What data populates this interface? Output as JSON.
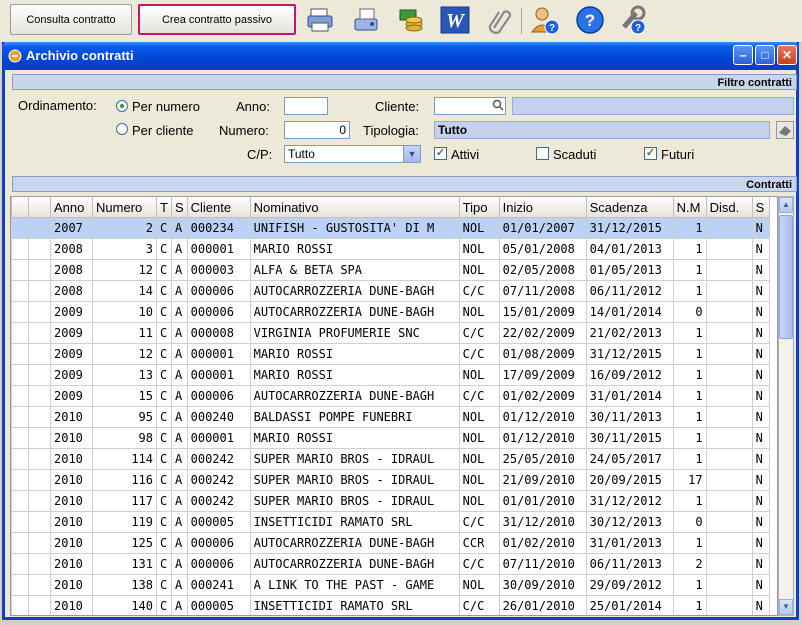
{
  "toolbar": {
    "btn_consulta": "Consulta contratto",
    "btn_crea": "Crea contratto passivo",
    "icons": [
      "printer-icon",
      "fax-icon",
      "money-icon",
      "word-icon",
      "paperclip-icon",
      "user-help-icon",
      "help-icon",
      "settings-help-icon"
    ]
  },
  "window": {
    "title": "Archivio contratti"
  },
  "filter": {
    "header": "Filtro contratti",
    "ordinamento_label": "Ordinamento:",
    "per_numero": "Per numero",
    "per_cliente": "Per cliente",
    "anno_label": "Anno:",
    "anno_value": "",
    "numero_label": "Numero:",
    "numero_value": "0",
    "cliente_label": "Cliente:",
    "cliente_value": "",
    "cliente_desc": "",
    "tipologia_label": "Tipologia:",
    "tipologia_value": "Tutto",
    "cp_label": "C/P:",
    "cp_value": "Tutto",
    "attivi": "Attivi",
    "scaduti": "Scaduti",
    "futuri": "Futuri",
    "attivi_checked": true,
    "scaduti_checked": false,
    "futuri_checked": true
  },
  "contracts": {
    "header": "Contratti",
    "columns": [
      "Anno",
      "Numero",
      "T",
      "S",
      "Cliente",
      "Nominativo",
      "Tipo",
      "Inizio",
      "Scadenza",
      "N.M",
      "Disd.",
      "S"
    ],
    "rows": [
      [
        "2007",
        "2",
        "C",
        "A",
        "000234",
        "UNIFISH - GUSTOSITA' DI M",
        "NOL",
        "01/01/2007",
        "31/12/2015",
        "1",
        "",
        "N"
      ],
      [
        "2008",
        "3",
        "C",
        "A",
        "000001",
        "MARIO ROSSI",
        "NOL",
        "05/01/2008",
        "04/01/2013",
        "1",
        "",
        "N"
      ],
      [
        "2008",
        "12",
        "C",
        "A",
        "000003",
        "ALFA & BETA SPA",
        "NOL",
        "02/05/2008",
        "01/05/2013",
        "1",
        "",
        "N"
      ],
      [
        "2008",
        "14",
        "C",
        "A",
        "000006",
        "AUTOCARROZZERIA DUNE-BAGH",
        "C/C",
        "07/11/2008",
        "06/11/2012",
        "1",
        "",
        "N"
      ],
      [
        "2009",
        "10",
        "C",
        "A",
        "000006",
        "AUTOCARROZZERIA DUNE-BAGH",
        "NOL",
        "15/01/2009",
        "14/01/2014",
        "0",
        "",
        "N"
      ],
      [
        "2009",
        "11",
        "C",
        "A",
        "000008",
        "VIRGINIA PROFUMERIE SNC",
        "C/C",
        "22/02/2009",
        "21/02/2013",
        "1",
        "",
        "N"
      ],
      [
        "2009",
        "12",
        "C",
        "A",
        "000001",
        "MARIO ROSSI",
        "C/C",
        "01/08/2009",
        "31/12/2015",
        "1",
        "",
        "N"
      ],
      [
        "2009",
        "13",
        "C",
        "A",
        "000001",
        "MARIO ROSSI",
        "NOL",
        "17/09/2009",
        "16/09/2012",
        "1",
        "",
        "N"
      ],
      [
        "2009",
        "15",
        "C",
        "A",
        "000006",
        "AUTOCARROZZERIA DUNE-BAGH",
        "C/C",
        "01/02/2009",
        "31/01/2014",
        "1",
        "",
        "N"
      ],
      [
        "2010",
        "95",
        "C",
        "A",
        "000240",
        "BALDASSI POMPE FUNEBRI",
        "NOL",
        "01/12/2010",
        "30/11/2013",
        "1",
        "",
        "N"
      ],
      [
        "2010",
        "98",
        "C",
        "A",
        "000001",
        "MARIO ROSSI",
        "NOL",
        "01/12/2010",
        "30/11/2015",
        "1",
        "",
        "N"
      ],
      [
        "2010",
        "114",
        "C",
        "A",
        "000242",
        "SUPER MARIO BROS - IDRAUL",
        "NOL",
        "25/05/2010",
        "24/05/2017",
        "1",
        "",
        "N"
      ],
      [
        "2010",
        "116",
        "C",
        "A",
        "000242",
        "SUPER MARIO BROS - IDRAUL",
        "NOL",
        "21/09/2010",
        "20/09/2015",
        "17",
        "",
        "N"
      ],
      [
        "2010",
        "117",
        "C",
        "A",
        "000242",
        "SUPER MARIO BROS - IDRAUL",
        "NOL",
        "01/01/2010",
        "31/12/2012",
        "1",
        "",
        "N"
      ],
      [
        "2010",
        "119",
        "C",
        "A",
        "000005",
        "INSETTICIDI RAMATO SRL",
        "C/C",
        "31/12/2010",
        "30/12/2013",
        "0",
        "",
        "N"
      ],
      [
        "2010",
        "125",
        "C",
        "A",
        "000006",
        "AUTOCARROZZERIA DUNE-BAGH",
        "CCR",
        "01/02/2010",
        "31/01/2013",
        "1",
        "",
        "N"
      ],
      [
        "2010",
        "131",
        "C",
        "A",
        "000006",
        "AUTOCARROZZERIA DUNE-BAGH",
        "C/C",
        "07/11/2010",
        "06/11/2013",
        "2",
        "",
        "N"
      ],
      [
        "2010",
        "138",
        "C",
        "A",
        "000241",
        "A LINK TO THE PAST - GAME",
        "NOL",
        "30/09/2010",
        "29/09/2012",
        "1",
        "",
        "N"
      ],
      [
        "2010",
        "140",
        "C",
        "A",
        "000005",
        "INSETTICIDI RAMATO SRL",
        "C/C",
        "26/01/2010",
        "25/01/2014",
        "1",
        "",
        "N"
      ]
    ]
  }
}
